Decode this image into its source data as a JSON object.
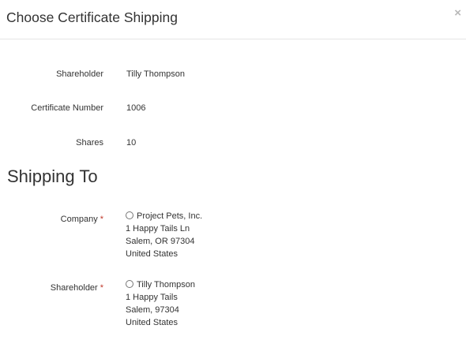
{
  "modal": {
    "title": "Choose Certificate Shipping",
    "close_label": "×"
  },
  "details": {
    "shareholder_label": "Shareholder",
    "shareholder_value": "Tilly Thompson",
    "certificate_label": "Certificate Number",
    "certificate_value": "1006",
    "shares_label": "Shares",
    "shares_value": "10"
  },
  "shipping": {
    "section_title": "Shipping To",
    "required_mark": "*",
    "company": {
      "label": "Company",
      "name": "Project Pets, Inc.",
      "address1": "1 Happy Tails Ln",
      "address2": "Salem, OR 97304",
      "country": "United States",
      "selected": false
    },
    "shareholder": {
      "label": "Shareholder",
      "name": "Tilly Thompson",
      "address1": "1 Happy Tails",
      "address2": "Salem, 97304",
      "country": "United States",
      "selected": false
    }
  }
}
